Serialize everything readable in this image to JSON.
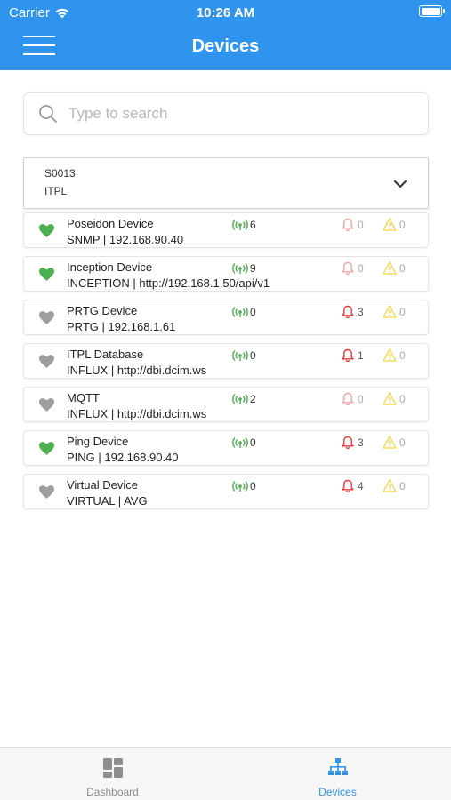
{
  "status_bar": {
    "carrier": "Carrier",
    "time": "10:26 AM"
  },
  "header": {
    "title": "Devices"
  },
  "search": {
    "placeholder": "Type to search",
    "value": ""
  },
  "site": {
    "code": "S0013",
    "name": "ITPL"
  },
  "colors": {
    "accent": "#2f94ee",
    "healthy": "#4caf50",
    "inactive": "#9e9e9e",
    "alarm": "#e53935",
    "alarm_muted": "#f2a5a3",
    "warning": "#f5d642",
    "signal": "#4caf50"
  },
  "devices": [
    {
      "name": "Poseidon Device",
      "detail": "SNMP | 192.168.90.40",
      "status": "healthy",
      "signals": "6",
      "alarms": "0",
      "warnings": "0",
      "alarms_active": false
    },
    {
      "name": "Inception Device",
      "detail": "INCEPTION | http://192.168.1.50/api/v1",
      "status": "healthy",
      "signals": "9",
      "alarms": "0",
      "warnings": "0",
      "alarms_active": false
    },
    {
      "name": "PRTG Device",
      "detail": "PRTG | 192.168.1.61",
      "status": "inactive",
      "signals": "0",
      "alarms": "3",
      "warnings": "0",
      "alarms_active": true
    },
    {
      "name": "ITPL Database",
      "detail": "INFLUX | http://dbi.dcim.ws",
      "status": "inactive",
      "signals": "0",
      "alarms": "1",
      "warnings": "0",
      "alarms_active": true
    },
    {
      "name": "MQTT",
      "detail": "INFLUX | http://dbi.dcim.ws",
      "status": "inactive",
      "signals": "2",
      "alarms": "0",
      "warnings": "0",
      "alarms_active": false
    },
    {
      "name": "Ping Device",
      "detail": "PING | 192.168.90.40",
      "status": "healthy",
      "signals": "0",
      "alarms": "3",
      "warnings": "0",
      "alarms_active": true
    },
    {
      "name": "Virtual Device",
      "detail": "VIRTUAL | AVG",
      "status": "inactive",
      "signals": "0",
      "alarms": "4",
      "warnings": "0",
      "alarms_active": true
    }
  ],
  "tabs": [
    {
      "label": "Dashboard",
      "icon": "dashboard-grid-icon",
      "active": false
    },
    {
      "label": "Devices",
      "icon": "network-tree-icon",
      "active": true
    }
  ]
}
